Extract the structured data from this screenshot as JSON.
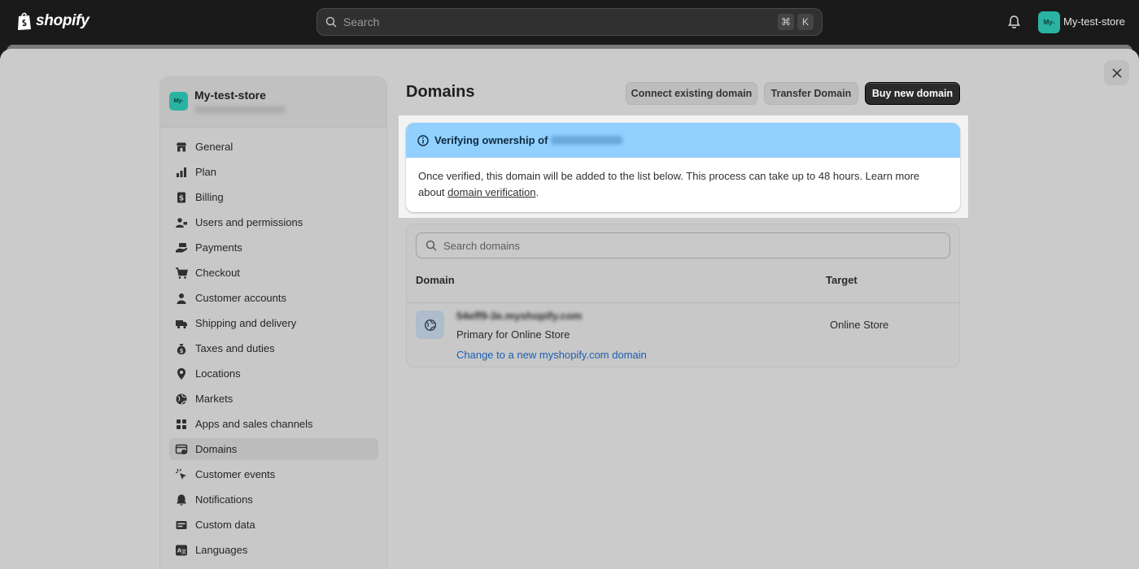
{
  "topbar": {
    "brand": "shopify",
    "search_placeholder": "Search",
    "shortcut_keys": [
      "⌘",
      "K"
    ],
    "store_initials": "My-",
    "store_name": "My-test-store"
  },
  "sidebar": {
    "store_initials": "My-",
    "store_name": "My-test-store",
    "items": [
      {
        "label": "General",
        "icon": "store-icon"
      },
      {
        "label": "Plan",
        "icon": "plan-chart-icon"
      },
      {
        "label": "Billing",
        "icon": "billing-icon"
      },
      {
        "label": "Users and permissions",
        "icon": "users-icon"
      },
      {
        "label": "Payments",
        "icon": "payments-hand-icon"
      },
      {
        "label": "Checkout",
        "icon": "cart-icon"
      },
      {
        "label": "Customer accounts",
        "icon": "person-icon"
      },
      {
        "label": "Shipping and delivery",
        "icon": "truck-icon"
      },
      {
        "label": "Taxes and duties",
        "icon": "money-bag-icon"
      },
      {
        "label": "Locations",
        "icon": "location-pin-icon"
      },
      {
        "label": "Markets",
        "icon": "globe-icon"
      },
      {
        "label": "Apps and sales channels",
        "icon": "apps-grid-icon"
      },
      {
        "label": "Domains",
        "icon": "domains-icon",
        "active": true
      },
      {
        "label": "Customer events",
        "icon": "cursor-click-icon"
      },
      {
        "label": "Notifications",
        "icon": "bell-icon"
      },
      {
        "label": "Custom data",
        "icon": "database-icon"
      },
      {
        "label": "Languages",
        "icon": "translate-icon"
      }
    ]
  },
  "main": {
    "title": "Domains",
    "buttons": {
      "connect": "Connect existing domain",
      "transfer": "Transfer Domain",
      "buy": "Buy new domain"
    },
    "banner": {
      "heading": "Verifying ownership of",
      "body_text": "Once verified, this domain will be added to the list below. This process can take up to 48 hours. Learn more about",
      "link": "domain verification",
      "trailing": "."
    },
    "domains_table": {
      "search_placeholder": "Search domains",
      "columns": [
        "Domain",
        "Target"
      ],
      "rows": [
        {
          "domain": "54eff9-3e.myshopify.com",
          "subtitle": "Primary for Online Store",
          "action_link": "Change to a new myshopify.com domain",
          "target": "Online Store"
        }
      ]
    }
  },
  "colors": {
    "topbar": "#1a1a1a",
    "overlay": "#cbcbcb",
    "banner_header": "#91d0ff",
    "primary_button": "#2b2b2b",
    "link": "#1d5fb3",
    "store_avatar": "#2ab3a3"
  }
}
